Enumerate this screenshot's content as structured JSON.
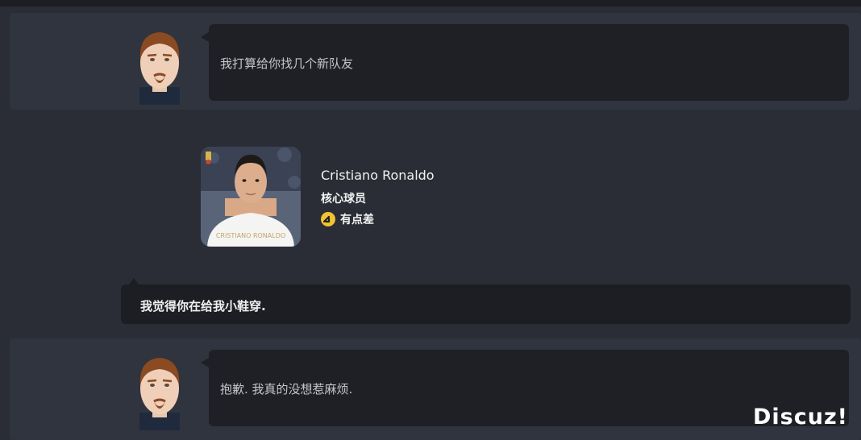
{
  "messages": [
    {
      "speaker": "manager",
      "text": "我打算给你找几个新队友"
    },
    {
      "speaker": "player_reply",
      "text": "我觉得你在给我小鞋穿."
    },
    {
      "speaker": "manager",
      "text": "抱歉. 我真的没想惹麻烦."
    }
  ],
  "player": {
    "name": "Cristiano Ronaldo",
    "role": "核心球员",
    "rating_label": "有点差",
    "shirt_text": "CRISTIANO RONALDO",
    "rating_icon": "down-arrow-icon",
    "rating_color": "#f2c230"
  },
  "watermark": "Discuz!",
  "colors": {
    "background": "#2a2d36",
    "panel": "#30343e",
    "bubble": "#1e2026"
  }
}
